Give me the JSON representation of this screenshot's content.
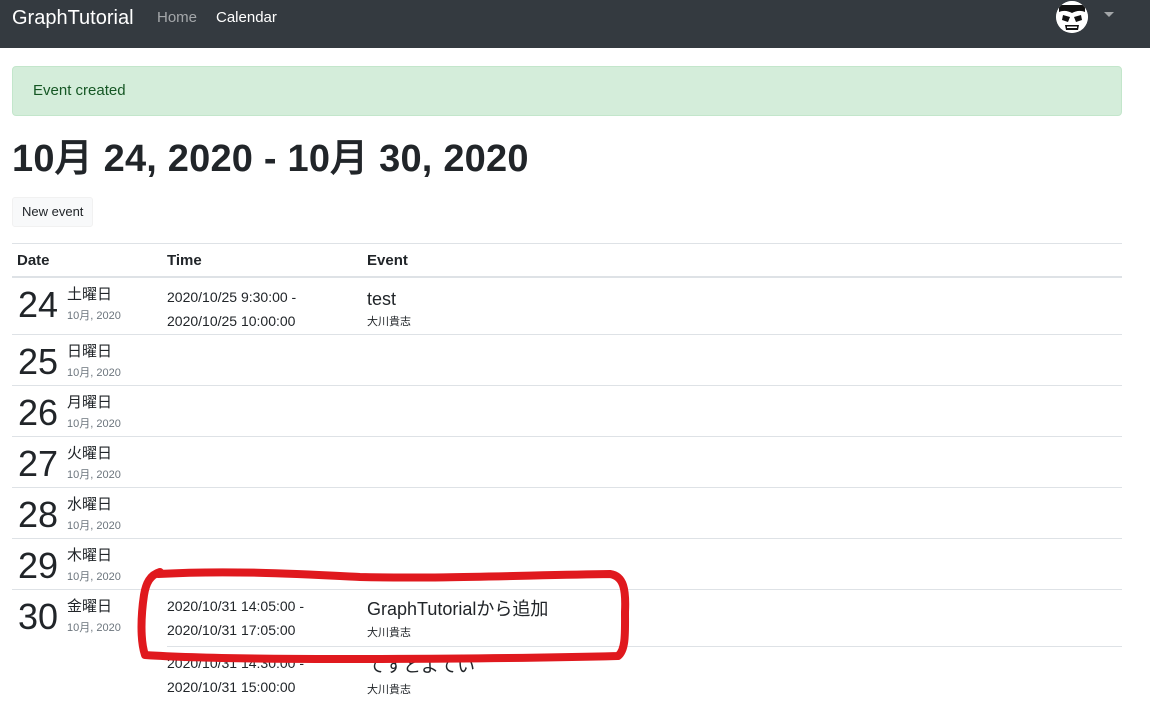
{
  "navbar": {
    "brand": "GraphTutorial",
    "links": [
      "Home",
      "Calendar"
    ],
    "active": "Calendar"
  },
  "alert": {
    "text": "Event created"
  },
  "page": {
    "title": "10月 24, 2020 - 10月 30, 2020",
    "new_event_label": "New event"
  },
  "table": {
    "headers": [
      "Date",
      "Time",
      "Event"
    ],
    "days": [
      {
        "day": "24",
        "weekday": "土曜日",
        "month_year": "10月, 2020",
        "events": [
          {
            "start": "2020/10/25 9:30:00 -",
            "end": "2020/10/25 10:00:00",
            "subject": "test",
            "organizer": "大川貴志"
          }
        ]
      },
      {
        "day": "25",
        "weekday": "日曜日",
        "month_year": "10月, 2020",
        "events": []
      },
      {
        "day": "26",
        "weekday": "月曜日",
        "month_year": "10月, 2020",
        "events": []
      },
      {
        "day": "27",
        "weekday": "火曜日",
        "month_year": "10月, 2020",
        "events": []
      },
      {
        "day": "28",
        "weekday": "水曜日",
        "month_year": "10月, 2020",
        "events": []
      },
      {
        "day": "29",
        "weekday": "木曜日",
        "month_year": "10月, 2020",
        "events": []
      },
      {
        "day": "30",
        "weekday": "金曜日",
        "month_year": "10月, 2020",
        "events": [
          {
            "start": "2020/10/31 14:05:00 -",
            "end": "2020/10/31 17:05:00",
            "subject": "GraphTutorialから追加",
            "organizer": "大川貴志"
          },
          {
            "start": "2020/10/31 14:30:00 -",
            "end": "2020/10/31 15:00:00",
            "subject": "てすとよてい",
            "organizer": "大川貴志"
          }
        ]
      }
    ]
  },
  "colors": {
    "navbar_bg": "#343a40",
    "alert_bg": "#d4edda",
    "alert_text": "#155724",
    "annotation": "#e0191e"
  },
  "icons": {
    "avatar": "avatar-icon",
    "dropdown": "caret-down-icon"
  }
}
